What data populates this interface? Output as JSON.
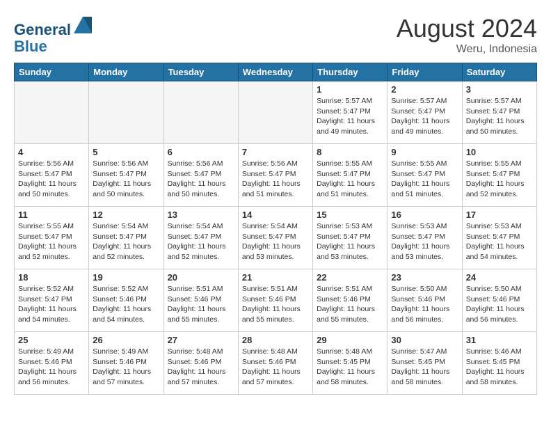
{
  "header": {
    "logo_line1": "General",
    "logo_line2": "Blue",
    "title": "August 2024",
    "subtitle": "Weru, Indonesia"
  },
  "weekdays": [
    "Sunday",
    "Monday",
    "Tuesday",
    "Wednesday",
    "Thursday",
    "Friday",
    "Saturday"
  ],
  "weeks": [
    [
      {
        "day": "",
        "info": ""
      },
      {
        "day": "",
        "info": ""
      },
      {
        "day": "",
        "info": ""
      },
      {
        "day": "",
        "info": ""
      },
      {
        "day": "1",
        "info": "Sunrise: 5:57 AM\nSunset: 5:47 PM\nDaylight: 11 hours\nand 49 minutes."
      },
      {
        "day": "2",
        "info": "Sunrise: 5:57 AM\nSunset: 5:47 PM\nDaylight: 11 hours\nand 49 minutes."
      },
      {
        "day": "3",
        "info": "Sunrise: 5:57 AM\nSunset: 5:47 PM\nDaylight: 11 hours\nand 50 minutes."
      }
    ],
    [
      {
        "day": "4",
        "info": "Sunrise: 5:56 AM\nSunset: 5:47 PM\nDaylight: 11 hours\nand 50 minutes."
      },
      {
        "day": "5",
        "info": "Sunrise: 5:56 AM\nSunset: 5:47 PM\nDaylight: 11 hours\nand 50 minutes."
      },
      {
        "day": "6",
        "info": "Sunrise: 5:56 AM\nSunset: 5:47 PM\nDaylight: 11 hours\nand 50 minutes."
      },
      {
        "day": "7",
        "info": "Sunrise: 5:56 AM\nSunset: 5:47 PM\nDaylight: 11 hours\nand 51 minutes."
      },
      {
        "day": "8",
        "info": "Sunrise: 5:55 AM\nSunset: 5:47 PM\nDaylight: 11 hours\nand 51 minutes."
      },
      {
        "day": "9",
        "info": "Sunrise: 5:55 AM\nSunset: 5:47 PM\nDaylight: 11 hours\nand 51 minutes."
      },
      {
        "day": "10",
        "info": "Sunrise: 5:55 AM\nSunset: 5:47 PM\nDaylight: 11 hours\nand 52 minutes."
      }
    ],
    [
      {
        "day": "11",
        "info": "Sunrise: 5:55 AM\nSunset: 5:47 PM\nDaylight: 11 hours\nand 52 minutes."
      },
      {
        "day": "12",
        "info": "Sunrise: 5:54 AM\nSunset: 5:47 PM\nDaylight: 11 hours\nand 52 minutes."
      },
      {
        "day": "13",
        "info": "Sunrise: 5:54 AM\nSunset: 5:47 PM\nDaylight: 11 hours\nand 52 minutes."
      },
      {
        "day": "14",
        "info": "Sunrise: 5:54 AM\nSunset: 5:47 PM\nDaylight: 11 hours\nand 53 minutes."
      },
      {
        "day": "15",
        "info": "Sunrise: 5:53 AM\nSunset: 5:47 PM\nDaylight: 11 hours\nand 53 minutes."
      },
      {
        "day": "16",
        "info": "Sunrise: 5:53 AM\nSunset: 5:47 PM\nDaylight: 11 hours\nand 53 minutes."
      },
      {
        "day": "17",
        "info": "Sunrise: 5:53 AM\nSunset: 5:47 PM\nDaylight: 11 hours\nand 54 minutes."
      }
    ],
    [
      {
        "day": "18",
        "info": "Sunrise: 5:52 AM\nSunset: 5:47 PM\nDaylight: 11 hours\nand 54 minutes."
      },
      {
        "day": "19",
        "info": "Sunrise: 5:52 AM\nSunset: 5:46 PM\nDaylight: 11 hours\nand 54 minutes."
      },
      {
        "day": "20",
        "info": "Sunrise: 5:51 AM\nSunset: 5:46 PM\nDaylight: 11 hours\nand 55 minutes."
      },
      {
        "day": "21",
        "info": "Sunrise: 5:51 AM\nSunset: 5:46 PM\nDaylight: 11 hours\nand 55 minutes."
      },
      {
        "day": "22",
        "info": "Sunrise: 5:51 AM\nSunset: 5:46 PM\nDaylight: 11 hours\nand 55 minutes."
      },
      {
        "day": "23",
        "info": "Sunrise: 5:50 AM\nSunset: 5:46 PM\nDaylight: 11 hours\nand 56 minutes."
      },
      {
        "day": "24",
        "info": "Sunrise: 5:50 AM\nSunset: 5:46 PM\nDaylight: 11 hours\nand 56 minutes."
      }
    ],
    [
      {
        "day": "25",
        "info": "Sunrise: 5:49 AM\nSunset: 5:46 PM\nDaylight: 11 hours\nand 56 minutes."
      },
      {
        "day": "26",
        "info": "Sunrise: 5:49 AM\nSunset: 5:46 PM\nDaylight: 11 hours\nand 57 minutes."
      },
      {
        "day": "27",
        "info": "Sunrise: 5:48 AM\nSunset: 5:46 PM\nDaylight: 11 hours\nand 57 minutes."
      },
      {
        "day": "28",
        "info": "Sunrise: 5:48 AM\nSunset: 5:46 PM\nDaylight: 11 hours\nand 57 minutes."
      },
      {
        "day": "29",
        "info": "Sunrise: 5:48 AM\nSunset: 5:45 PM\nDaylight: 11 hours\nand 58 minutes."
      },
      {
        "day": "30",
        "info": "Sunrise: 5:47 AM\nSunset: 5:45 PM\nDaylight: 11 hours\nand 58 minutes."
      },
      {
        "day": "31",
        "info": "Sunrise: 5:46 AM\nSunset: 5:45 PM\nDaylight: 11 hours\nand 58 minutes."
      }
    ]
  ]
}
